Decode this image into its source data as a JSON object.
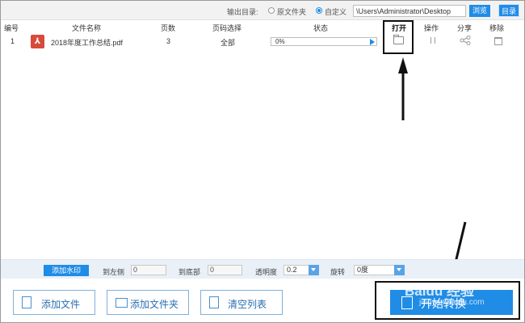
{
  "output_bar": {
    "label": "输出目录:",
    "option_original": "原文件夹",
    "option_custom": "自定义",
    "selected": "自定义",
    "path": "\\Users\\Administrator\\Desktop",
    "browse_label": "浏览",
    "catalog_label": "目录"
  },
  "table": {
    "headers": {
      "no": "编号",
      "name": "文件名称",
      "pages": "页数",
      "range": "页码选择",
      "status": "状态",
      "open": "打开",
      "op": "操作",
      "share": "分享",
      "remove": "移除"
    },
    "rows": [
      {
        "no": "1",
        "icon": "pdf-file-icon",
        "name": "2018年度工作总结.pdf",
        "pages": "3",
        "range": "全部",
        "progress_text": "0%",
        "progress": 0
      }
    ]
  },
  "watermark_bar": {
    "add_watermark": "添加水印",
    "to_left_label": "到左侧",
    "to_left_value": "0",
    "to_bottom_label": "到底部",
    "to_bottom_value": "0",
    "opacity_label": "透明度",
    "opacity_value": "0.2",
    "rotate_label": "旋转",
    "rotate_value": "0度"
  },
  "buttons": {
    "add_file": "添加文件",
    "add_folder": "添加文件夹",
    "clear_list": "清空列表",
    "start": "开始转换"
  },
  "watermark": {
    "brand": "Baidu 经验",
    "url": "jingyan.baidu.com"
  },
  "colors": {
    "accent": "#1f8ce6",
    "annotation": "#111111"
  }
}
